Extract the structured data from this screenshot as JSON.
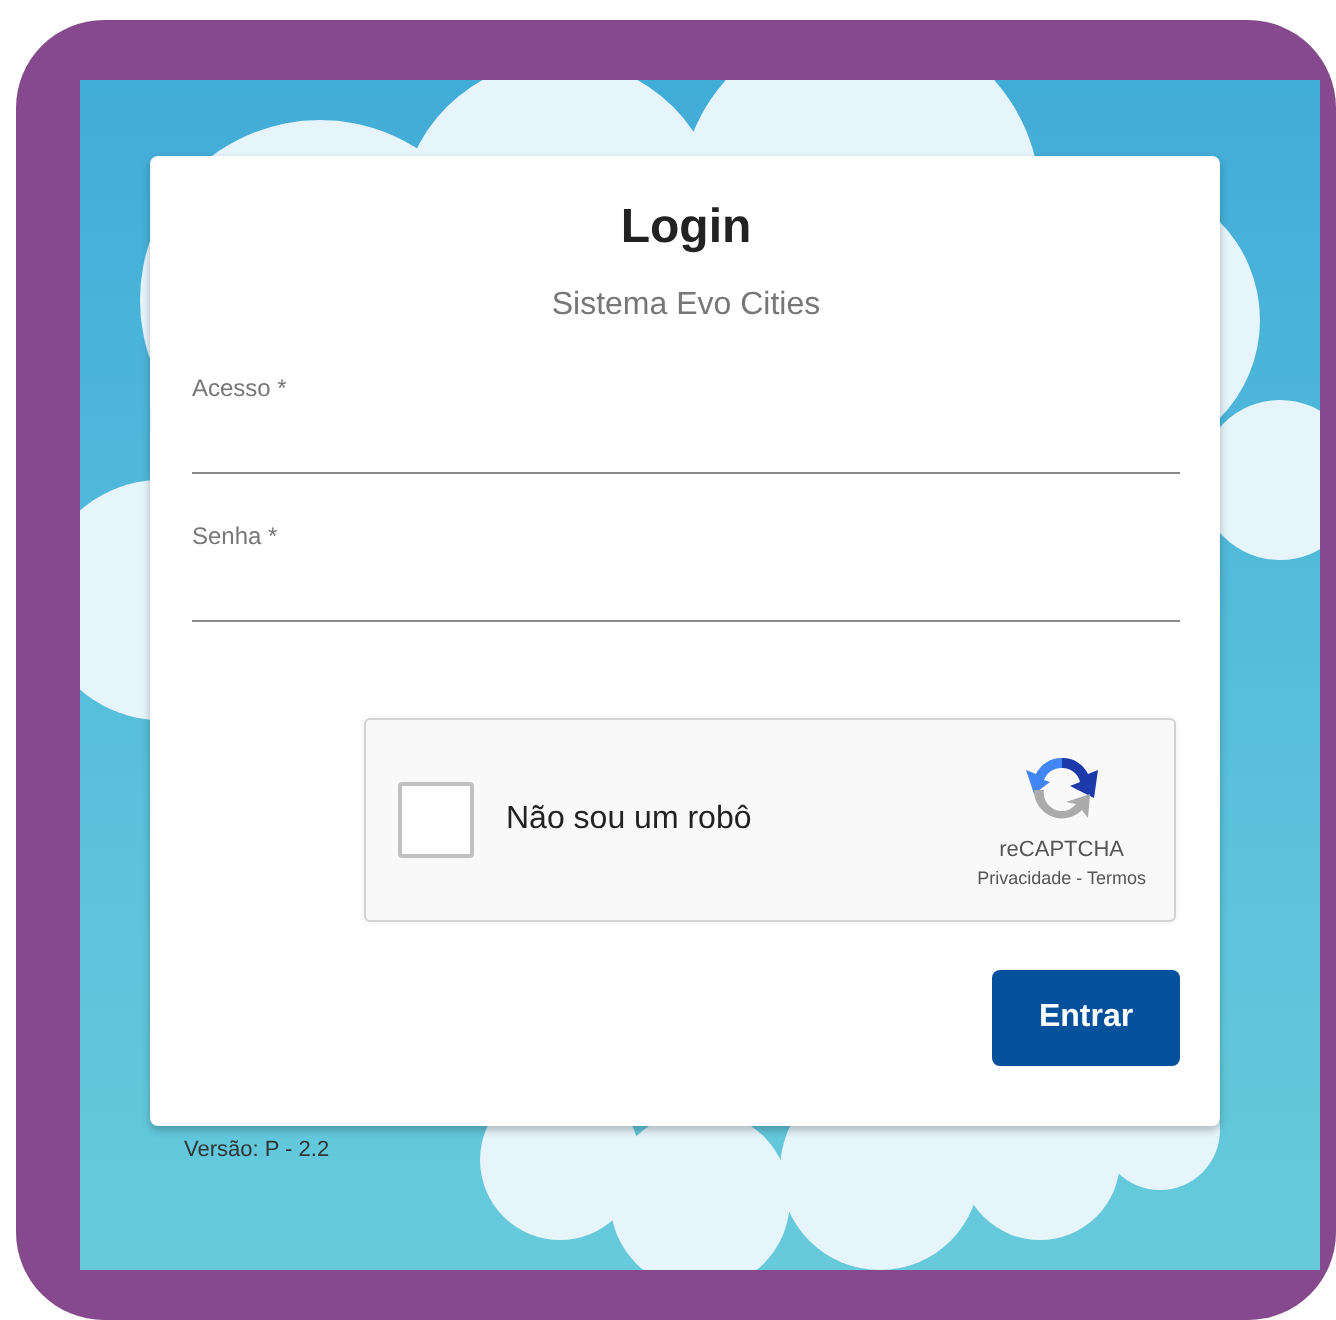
{
  "login": {
    "title": "Login",
    "subtitle": "Sistema Evo Cities",
    "fields": [
      {
        "label": "Acesso *"
      },
      {
        "label": "Senha *"
      }
    ],
    "captcha": {
      "checked": false,
      "label": "Não sou um robô",
      "brand": "reCAPTCHA",
      "links": "Privacidade - Termos"
    },
    "button": "Entrar"
  },
  "version": "Versão: P - 2.2"
}
